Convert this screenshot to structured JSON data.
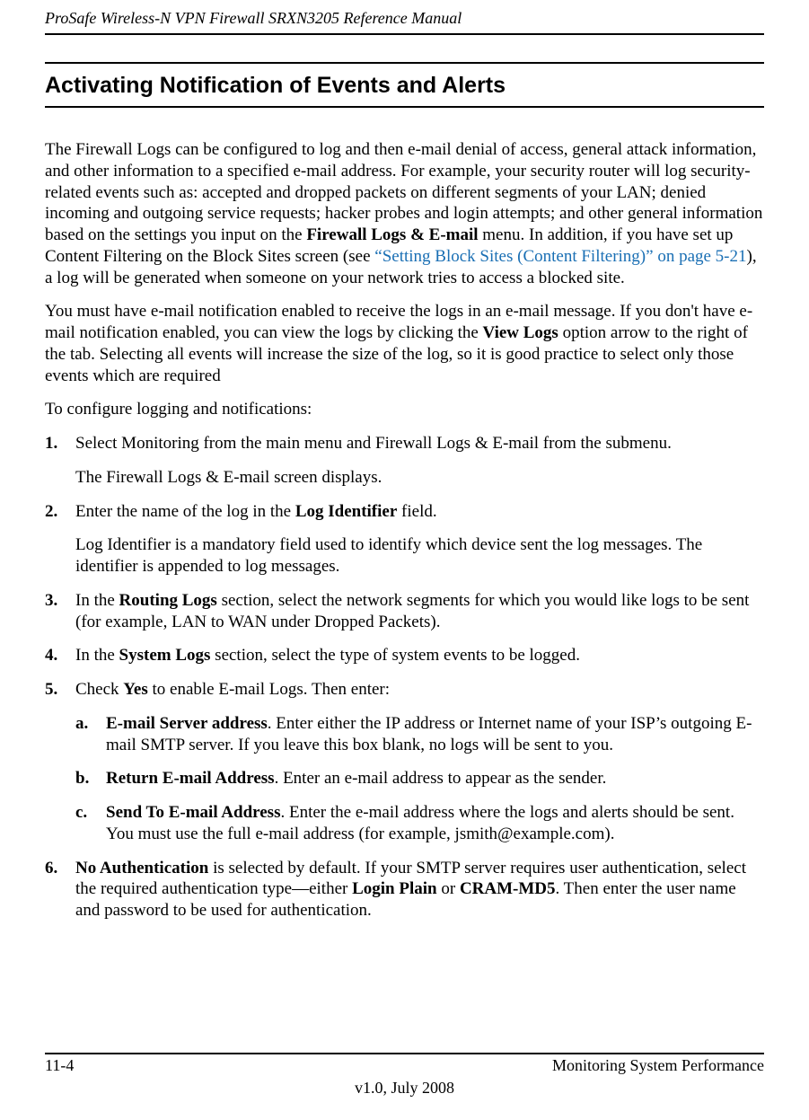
{
  "header": {
    "running_title": "ProSafe Wireless-N VPN Firewall SRXN3205 Reference Manual"
  },
  "section": {
    "title": "Activating Notification of Events and Alerts"
  },
  "body": {
    "p1_pre": "The Firewall Logs can be configured to log and then e-mail denial of access, general attack information, and other information to a specified e-mail address. For example, your security router will log security-related events such as: accepted and dropped packets on different segments of your LAN; denied incoming and outgoing service requests; hacker probes and login attempts; and other general information based on the settings you input on the ",
    "p1_bold1": "Firewall Logs & E-mail",
    "p1_mid": " menu. In addition, if you have set up Content Filtering on the Block Sites screen (see ",
    "p1_link": "“Setting Block Sites (Content Filtering)” on page 5-21",
    "p1_post": "), a log will be generated when someone on your network tries to access a blocked site.",
    "p2_pre": "You must have e-mail notification enabled to receive the logs in an e-mail message. If you don't have e-mail notification enabled, you can view the logs by clicking the ",
    "p2_bold1": "View Logs",
    "p2_post": " option arrow to the right of the tab. Selecting all events will increase the size of the log, so it is good practice to select only those events which are required",
    "p3": "To configure logging and notifications:"
  },
  "steps": {
    "s1": {
      "n": "1.",
      "text": "Select Monitoring from the main menu and Firewall Logs & E-mail from the submenu.",
      "after": "The Firewall Logs & E-mail screen displays."
    },
    "s2": {
      "n": "2.",
      "pre": "Enter the name of the log in the ",
      "bold": "Log Identifier",
      "post": " field.",
      "after": "Log Identifier is a mandatory field used to identify which device sent the log messages. The identifier is appended to log messages."
    },
    "s3": {
      "n": "3.",
      "pre": "In the ",
      "bold": "Routing Logs",
      "post": " section, select the network segments for which you would like logs to be sent (for example, LAN to WAN under Dropped Packets)."
    },
    "s4": {
      "n": "4.",
      "pre": "In the ",
      "bold": "System Logs",
      "post": " section, select the type of system events to be logged."
    },
    "s5": {
      "n": "5.",
      "pre": "Check ",
      "bold": "Yes",
      "post": " to enable E-mail Logs. Then enter:"
    },
    "s5a": {
      "n": "a.",
      "bold": "E-mail Server address",
      "post": ". Enter either the IP address or Internet name of your ISP’s outgoing E-mail SMTP server. If you leave this box blank, no logs will be sent to you."
    },
    "s5b": {
      "n": "b.",
      "bold": "Return E-mail Address",
      "post": ". Enter an e-mail address to appear as the sender."
    },
    "s5c": {
      "n": "c.",
      "bold": "Send To E-mail Address",
      "post": ". Enter the e-mail address where the logs and alerts should be sent. You must use the full e-mail address (for example, jsmith@example.com)."
    },
    "s6": {
      "n": "6.",
      "bold1": "No Authentication",
      "mid1": " is selected by default. If your SMTP server requires user authentication, select the required authentication type—either ",
      "bold2": "Login Plain",
      "mid2": " or ",
      "bold3": "CRAM-MD5",
      "post": ". Then enter the user name and password to be used for authentication."
    }
  },
  "footer": {
    "page_num": "11-4",
    "right": "Monitoring System Performance",
    "version": "v1.0, July 2008"
  }
}
